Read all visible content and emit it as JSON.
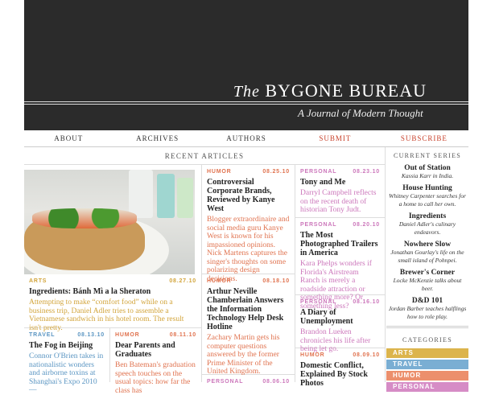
{
  "header": {
    "title_prefix": "The",
    "title": "BYGONE BUREAU",
    "subtitle": "A Journal of Modern Thought"
  },
  "nav": [
    "ABOUT",
    "ARCHIVES",
    "AUTHORS",
    "SUBMIT",
    "SUBSCRIBE"
  ],
  "recent_heading": "RECENT ARTICLES",
  "featured": {
    "cat": "ARTS",
    "date": "08.27.10",
    "title": "Ingredients: Bánh Mì a la Sheraton",
    "desc": "Attempting to make “comfort food” while on a business trip, Daniel Adler tries to assemble a Vietnamese sandwich in his hotel room. The result isn't pretty."
  },
  "articles": [
    {
      "cat": "TRAVEL",
      "date": "08.13.10",
      "title": "The Fog in Beijing",
      "desc": "Connor O'Brien takes in nationalistic wonders and airborne toxins at Shanghai's Expo 2010 —"
    },
    {
      "cat": "HUMOR",
      "date": "08.11.10",
      "title": "Dear Parents and Graduates",
      "desc": "Ben Bateman's graduation speech touches on the usual topics: how far the class has"
    },
    {
      "cat": "HUMOR",
      "date": "08.25.10",
      "title": "Controversial Corporate Brands, Reviewed by Kanye West",
      "desc": "Blogger extraordinaire and social media guru Kanye West is known for his impassioned opinions. Nick Martens captures the singer's thoughts on some polarizing design decisions."
    },
    {
      "cat": "HUMOR",
      "date": "08.18.10",
      "title": "Arthur Neville Chamberlain Answers the Information Technology Help Desk Hotline",
      "desc": "Zachary Martin gets his computer questions answered by the former Prime Minister of the United Kingdom."
    },
    {
      "cat": "PERSONAL",
      "date": "08.06.10"
    },
    {
      "cat": "PERSONAL",
      "date": "08.23.10",
      "title": "Tony and Me",
      "desc": "Darryl Campbell reflects on the recent death of historian Tony Judt."
    },
    {
      "cat": "PERSONAL",
      "date": "08.20.10",
      "title": "The Most Photographed Trailers in America",
      "desc": "Kara Phelps wonders if Florida's Airstream Ranch is merely a roadside attraction or something more? Or something less?"
    },
    {
      "cat": "PERSONAL",
      "date": "08.16.10",
      "title": "A Diary of Unemployment",
      "desc": "Brandon Lueken chronicles his life after being let go."
    },
    {
      "cat": "HUMOR",
      "date": "08.09.10",
      "title": "Domestic Conflict, Explained By Stock Photos"
    }
  ],
  "sidebar": {
    "series_heading": "CURRENT SERIES",
    "series": [
      {
        "title": "Out of Station",
        "desc": "Kassia Karr in India."
      },
      {
        "title": "House Hunting",
        "desc": "Whitney Carpenter searches for a home to call her own."
      },
      {
        "title": "Ingredients",
        "desc": "Daniel Adler's culinary endeavors."
      },
      {
        "title": "Nowhere Slow",
        "desc": "Jonathan Gourlay's life on the small island of Pohnpei."
      },
      {
        "title": "Brewer's Corner",
        "desc": "Locke McKenzie talks about beer."
      },
      {
        "title": "D&D 101",
        "desc": "Jordan Barber teaches halflings how to role play."
      }
    ],
    "categories_heading": "CATEGORIES",
    "categories": [
      {
        "label": "ARTS",
        "color": "#dcb44c"
      },
      {
        "label": "TRAVEL",
        "color": "#7aaed3"
      },
      {
        "label": "HUMOR",
        "color": "#ec8f6c"
      },
      {
        "label": "PERSONAL",
        "color": "#d68cc6"
      }
    ]
  }
}
